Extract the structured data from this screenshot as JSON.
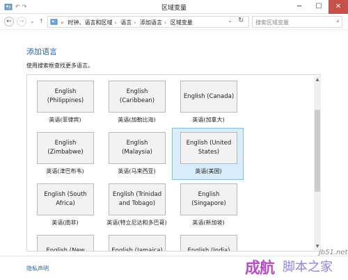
{
  "window": {
    "title": "区域变量",
    "icons": [
      "control-panel-icon",
      "undo-icon",
      "redo-icon"
    ]
  },
  "nav": {
    "breadcrumb_root_marker": "«",
    "breadcrumbs": [
      "时钟、语言和区域",
      "语言",
      "添加语言",
      "区域变量"
    ],
    "search_placeholder": "搜索区域变量"
  },
  "main": {
    "title": "添加语言",
    "instruction": "使用搜索框查找更多语言。"
  },
  "languages": [
    {
      "name": "English\n(Philippines)",
      "native": "英语(菲律宾)",
      "selected": false
    },
    {
      "name": "English\n(Caribbean)",
      "native": "英语(加勒比海)",
      "selected": false
    },
    {
      "name": "English (Canada)",
      "native": "英语(加拿大)",
      "selected": false
    },
    {
      "name": "English\n(Zimbabwe)",
      "native": "英语(津巴布韦)",
      "selected": false
    },
    {
      "name": "English (Malaysia)",
      "native": "英语(马来西亚)",
      "selected": false
    },
    {
      "name": "English (United\nStates)",
      "native": "英语(美国)",
      "selected": true
    },
    {
      "name": "English (South\nAfrica)",
      "native": "英语(南非)",
      "selected": false
    },
    {
      "name": "English (Trinidad\nand Tobago)",
      "native": "英语(特立尼达和多巴哥)",
      "selected": false
    },
    {
      "name": "English\n(Singapore)",
      "native": "英语(新加坡)",
      "selected": false
    },
    {
      "name": "English (New",
      "native": "",
      "selected": false
    },
    {
      "name": "English (Jamaica)",
      "native": "",
      "selected": false
    },
    {
      "name": "English (India)",
      "native": "",
      "selected": false
    }
  ],
  "footer": {
    "privacy_link": "隐私声明"
  },
  "watermark": {
    "site": "jb51.net",
    "text": "成航",
    "text2": "脚本之家"
  },
  "colors": {
    "accent": "#2c63a8",
    "selected_bg": "#d9ecfb",
    "selected_border": "#86bbe6",
    "close_button": "#c7504a"
  }
}
